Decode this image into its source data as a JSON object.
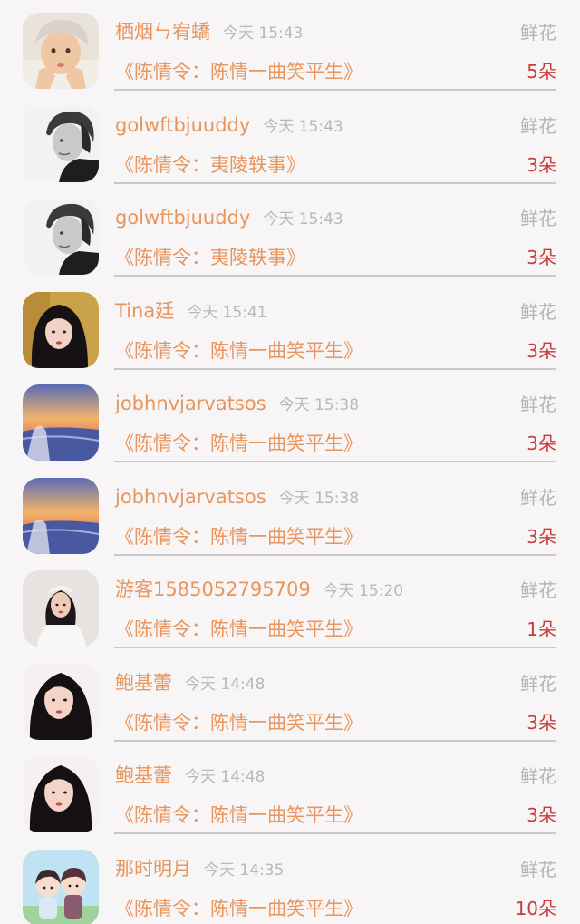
{
  "rows": [
    {
      "name": "栖烟ㄣ宥蟜",
      "time": "今天 15:43",
      "gift": "鲜花",
      "novel": "《陈情令：陈情一曲笑平生》",
      "count": "5朵",
      "avatar": "boy-beige"
    },
    {
      "name": "golwftbjuuddy",
      "time": "今天 15:43",
      "gift": "鲜花",
      "novel": "《陈情令：夷陵轶事》",
      "count": "3朵",
      "avatar": "man-bw"
    },
    {
      "name": "golwftbjuuddy",
      "time": "今天 15:43",
      "gift": "鲜花",
      "novel": "《陈情令：夷陵轶事》",
      "count": "3朵",
      "avatar": "man-bw"
    },
    {
      "name": "Tina廷",
      "time": "今天 15:41",
      "gift": "鲜花",
      "novel": "《陈情令：陈情一曲笑平生》",
      "count": "3朵",
      "avatar": "girl-dark"
    },
    {
      "name": "jobhnvjarvatsos",
      "time": "今天 15:38",
      "gift": "鲜花",
      "novel": "《陈情令：陈情一曲笑平生》",
      "count": "3朵",
      "avatar": "sunset"
    },
    {
      "name": "jobhnvjarvatsos",
      "time": "今天 15:38",
      "gift": "鲜花",
      "novel": "《陈情令：陈情一曲笑平生》",
      "count": "3朵",
      "avatar": "sunset"
    },
    {
      "name": "游客1585052795709",
      "time": "今天 15:20",
      "gift": "鲜花",
      "novel": "《陈情令：陈情一曲笑平生》",
      "count": "1朵",
      "avatar": "girl-white"
    },
    {
      "name": "鲍基蕾",
      "time": "今天 14:48",
      "gift": "鲜花",
      "novel": "《陈情令：陈情一曲笑平生》",
      "count": "3朵",
      "avatar": "woman-long-hair"
    },
    {
      "name": "鲍基蕾",
      "time": "今天 14:48",
      "gift": "鲜花",
      "novel": "《陈情令：陈情一曲笑平生》",
      "count": "3朵",
      "avatar": "woman-long-hair"
    },
    {
      "name": "那时明月",
      "time": "今天 14:35",
      "gift": "鲜花",
      "novel": "《陈情令：陈情一曲笑平生》",
      "count": "10朵",
      "avatar": "cartoon-couple"
    }
  ],
  "colors": {
    "accent": "#e8955e",
    "count": "#c83c3c",
    "muted": "#b5b5b5",
    "background": "#f7f5f5"
  }
}
